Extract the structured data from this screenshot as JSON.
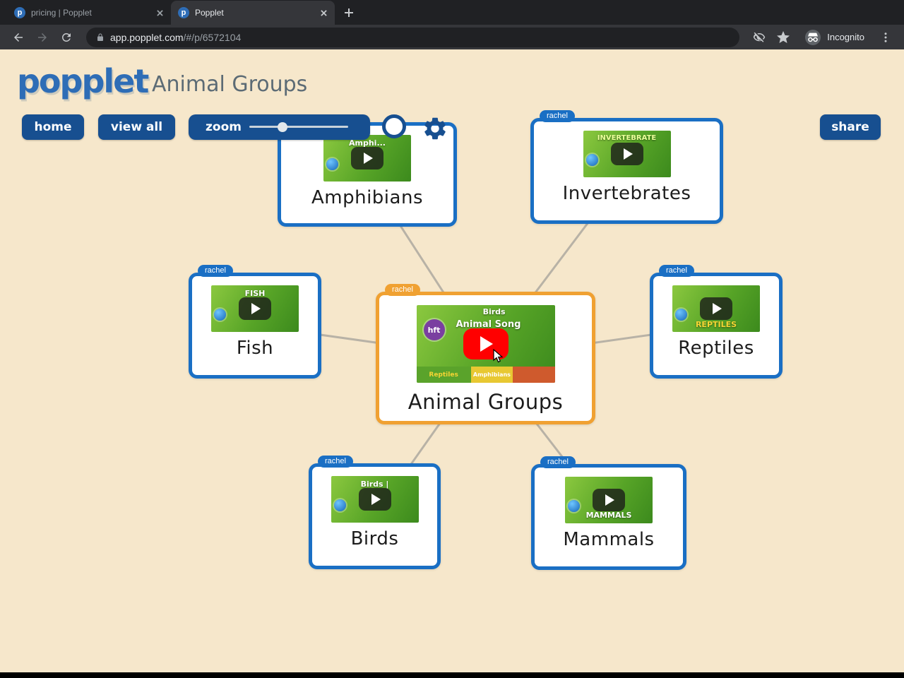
{
  "browser": {
    "tabs": [
      {
        "title": "pricing | Popplet",
        "favicon": "p"
      },
      {
        "title": "Popplet",
        "favicon": "p"
      }
    ],
    "url_domain": "app.popplet.com",
    "url_path": "/#/p/6572104",
    "incognito_label": "Incognito"
  },
  "header": {
    "logo": "popplet",
    "title": "Animal Groups"
  },
  "toolbar": {
    "home": "home",
    "view_all": "view all",
    "zoom": "zoom",
    "share": "share"
  },
  "map": {
    "center": {
      "label": "Animal Groups",
      "tag": "rachel",
      "video_title": "Animal Song",
      "thumb_top": "Birds",
      "channel_badge": "hft",
      "strip": [
        "Reptiles",
        "Amphibians"
      ]
    },
    "nodes": [
      {
        "label": "Amphibians",
        "tag": "",
        "thumb_text": "Amphi..."
      },
      {
        "label": "Invertebrates",
        "tag": "rachel",
        "thumb_text": "INVERTEBRATE"
      },
      {
        "label": "Fish",
        "tag": "rachel",
        "thumb_text": "FISH"
      },
      {
        "label": "Reptiles",
        "tag": "rachel",
        "thumb_text": "REPTILES"
      },
      {
        "label": "Birds",
        "tag": "rachel",
        "thumb_text": "Birds |"
      },
      {
        "label": "Mammals",
        "tag": "rachel",
        "thumb_text": "MAMMALS"
      }
    ]
  },
  "colors": {
    "popplet_blue": "#174f90",
    "node_border_blue": "#1a6fc4",
    "center_border_orange": "#f0a132",
    "background_cream": "#f6e7cb",
    "play_red": "#ff0000"
  }
}
